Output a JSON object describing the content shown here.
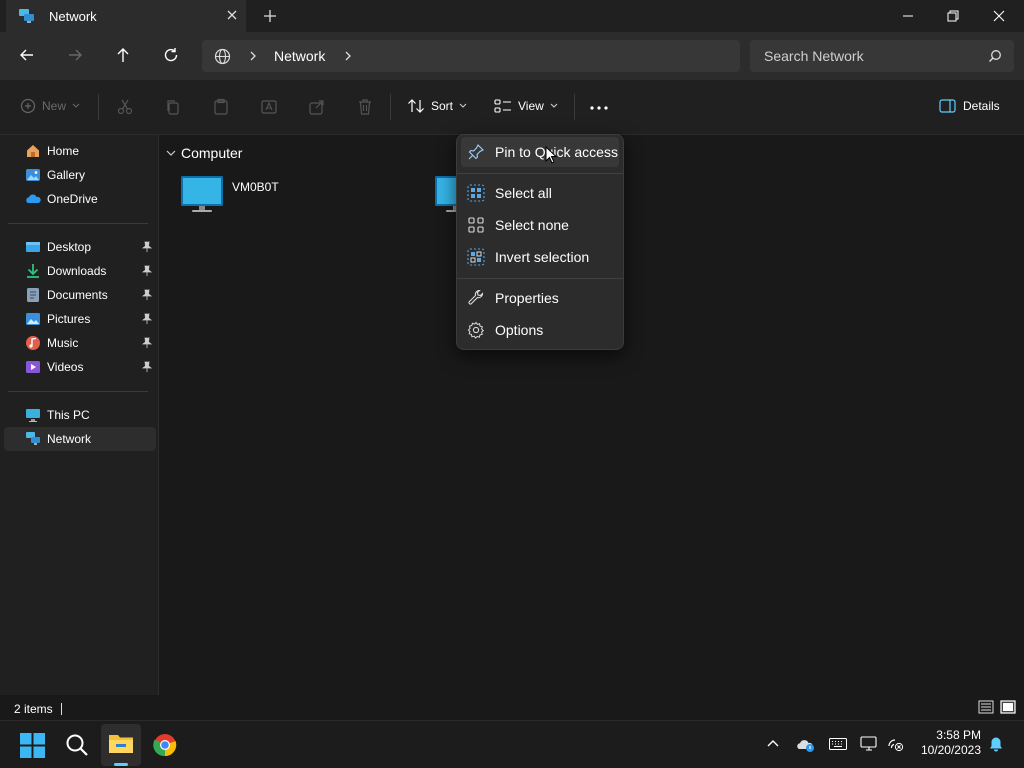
{
  "window": {
    "tab_title": "Network",
    "new_tab_symbol": "+"
  },
  "address": {
    "segments": [
      "Network"
    ],
    "search_placeholder": "Search Network"
  },
  "commandbar": {
    "new_label": "New",
    "sort_label": "Sort",
    "view_label": "View",
    "more_label": "...",
    "details_label": "Details"
  },
  "sidebar": {
    "items": [
      {
        "label": "Home",
        "icon": "home-icon"
      },
      {
        "label": "Gallery",
        "icon": "gallery-icon"
      },
      {
        "label": "OneDrive",
        "icon": "onedrive-icon"
      },
      {
        "label": "Desktop",
        "icon": "desktop-folder-icon",
        "pinned": true
      },
      {
        "label": "Downloads",
        "icon": "downloads-folder-icon",
        "pinned": true
      },
      {
        "label": "Documents",
        "icon": "documents-folder-icon",
        "pinned": true
      },
      {
        "label": "Pictures",
        "icon": "pictures-folder-icon",
        "pinned": true
      },
      {
        "label": "Music",
        "icon": "music-folder-icon",
        "pinned": true
      },
      {
        "label": "Videos",
        "icon": "videos-folder-icon",
        "pinned": true
      },
      {
        "label": "This PC",
        "icon": "this-pc-icon"
      },
      {
        "label": "Network",
        "icon": "network-icon",
        "selected": true
      }
    ]
  },
  "content": {
    "group_title": "Computer",
    "items": [
      {
        "name": "VM0B0T",
        "icon": "computer-icon"
      },
      {
        "name": "",
        "icon": "computer-icon"
      }
    ]
  },
  "context_menu": {
    "items": [
      {
        "label": "Pin to Quick access",
        "icon": "pin-icon"
      },
      {
        "label": "Select all",
        "icon": "select-all-icon"
      },
      {
        "label": "Select none",
        "icon": "select-none-icon"
      },
      {
        "label": "Invert selection",
        "icon": "invert-selection-icon"
      },
      {
        "label": "Properties",
        "icon": "wrench-icon"
      },
      {
        "label": "Options",
        "icon": "gear-icon"
      }
    ]
  },
  "status": {
    "item_count": "2 items"
  },
  "taskbar": {
    "time": "3:58 PM",
    "date": "10/20/2023"
  },
  "colors": {
    "accent": "#60cdff",
    "background": "#191919",
    "pane": "#202020",
    "menu": "#2c2c2c"
  }
}
